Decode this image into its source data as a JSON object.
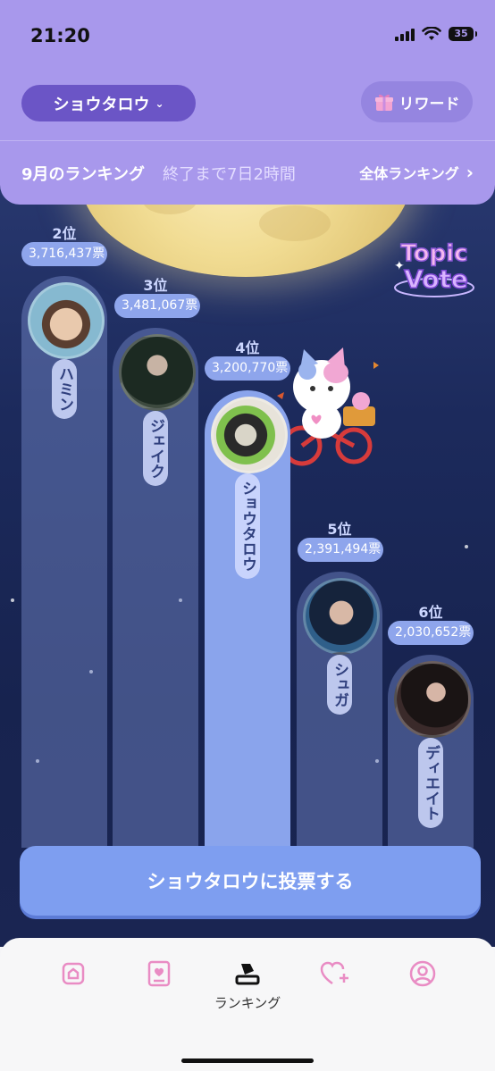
{
  "status_bar": {
    "time": "21:20",
    "battery": "35"
  },
  "header": {
    "artist_selector": "ショウタロウ",
    "reward_label": "リワード",
    "month_title": "9月のランキング",
    "countdown": "終了まで7日2時間",
    "all_ranking_label": "全体ランキング"
  },
  "badge": {
    "line1": "Topic",
    "line2": "Vote"
  },
  "rankings": [
    {
      "rank": "2位",
      "votes": "3,716,437票",
      "name": "ハミン"
    },
    {
      "rank": "3位",
      "votes": "3,481,067票",
      "name": "ジェイク"
    },
    {
      "rank": "4位",
      "votes": "3,200,770票",
      "name": "ショウタロウ"
    },
    {
      "rank": "5位",
      "votes": "2,391,494票",
      "name": "シュガ"
    },
    {
      "rank": "6位",
      "votes": "2,030,652票",
      "name": "ディエイト"
    }
  ],
  "vote_button": "ショウタロウに投票する",
  "tabbar": {
    "items": [
      "home-icon",
      "card-icon",
      "ranking-icon",
      "heart-plus-icon",
      "profile-icon"
    ],
    "active_label": "ランキング"
  },
  "colors": {
    "header_bg": "#a898ec",
    "selector_bg": "#6b55c6",
    "accent": "#7e9ef0",
    "tab_icon_pink": "#e98cc4"
  }
}
